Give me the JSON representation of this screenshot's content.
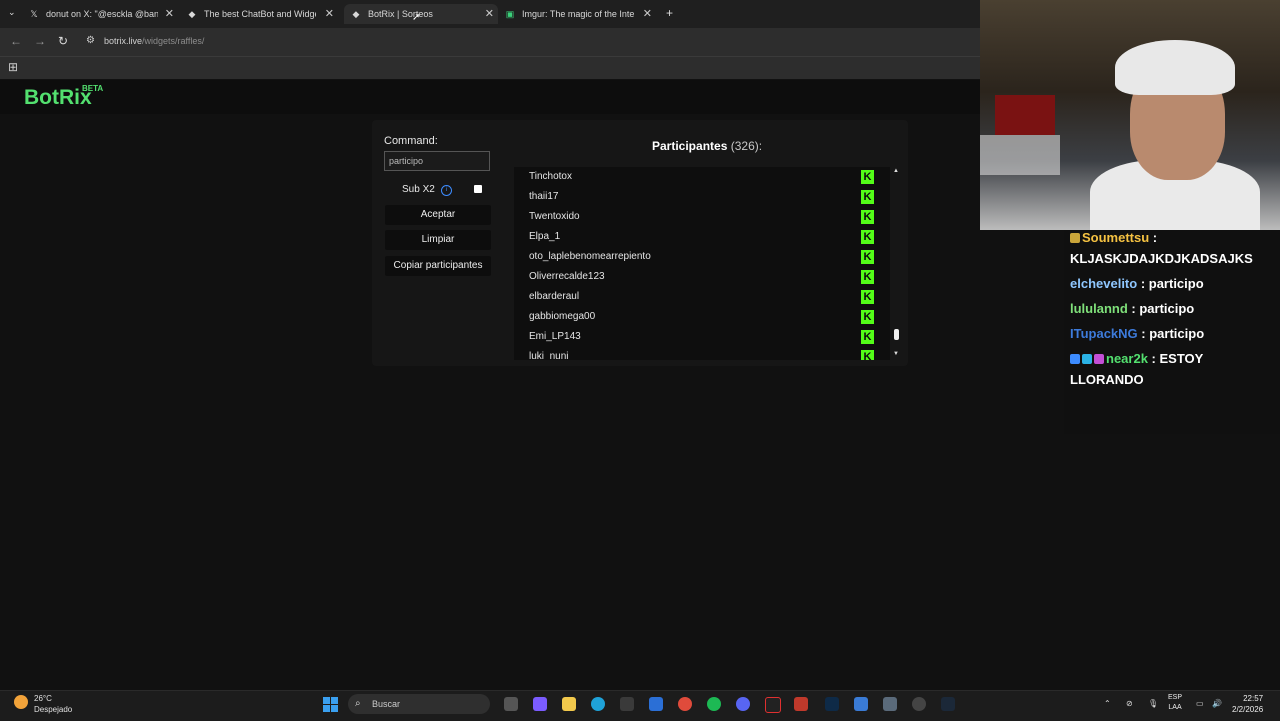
{
  "browser": {
    "tabs": [
      {
        "title": "donut on X: \"@esckla @banani",
        "icon": "x-icon"
      },
      {
        "title": "The best ChatBot and Widgets",
        "icon": "botrix-icon"
      },
      {
        "title": "BotRix | Sorteos",
        "icon": "botrix-icon"
      },
      {
        "title": "Imgur: The magic of the Interne",
        "icon": "imgur-icon"
      }
    ],
    "url_host": "botrix.live",
    "url_path": "/widgets/raffles/"
  },
  "site": {
    "logo": "BotRix",
    "badge": "BETA"
  },
  "raffle": {
    "command_label": "Command:",
    "command_value": "participo",
    "sub_label": "Sub X2",
    "sub_checked": false,
    "accept_label": "Aceptar",
    "clear_label": "Limpiar",
    "copy_label": "Copiar participantes",
    "participants_label": "Participantes",
    "participants_count": "(326):",
    "participants": [
      "Tinchotox",
      "thaii17",
      "Twentoxido",
      "Elpa_1",
      "oto_laplebenomearrepiento",
      "Oliverrecalde123",
      "elbarderaul",
      "gabbiomega00",
      "Emi_LP143",
      "luki_nuni"
    ],
    "platform_icon": "kick-icon",
    "scroll_position": 0.88
  },
  "stream_chat": [
    {
      "user": "Soumettsu",
      "text": "KLJASKJDAJKDJKADSAJKS",
      "color": "#f5c242"
    },
    {
      "user": "elchevelito",
      "text": "participo",
      "color": "#8fc7ff"
    },
    {
      "user": "lululannd",
      "text": "participo",
      "color": "#7fe07a"
    },
    {
      "user": "ITupackNG",
      "text": "participo",
      "color": "#3d7bdb"
    },
    {
      "user": "near2k",
      "text": "ESTOY LLORANDO",
      "color": "#53e06f"
    }
  ],
  "taskbar": {
    "weather_temp": "26°C",
    "weather_desc": "Despejado",
    "search_placeholder": "Buscar",
    "lang_top": "ESP",
    "lang_bottom": "LAA",
    "time": "22:57",
    "date": "2/2/2026"
  },
  "colors": {
    "brand": "#53e06f",
    "kick": "#53fc18",
    "info": "#3d8cff"
  }
}
